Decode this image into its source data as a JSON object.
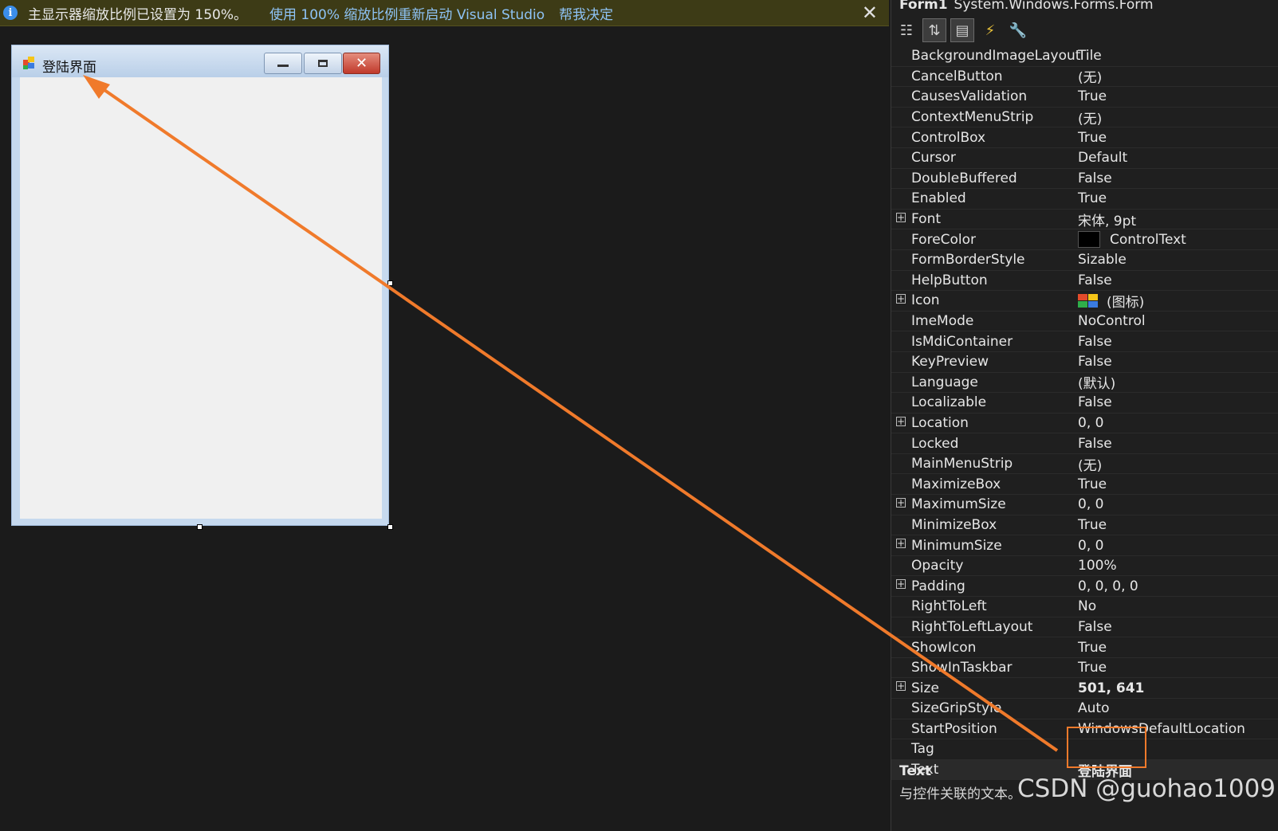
{
  "infobar": {
    "icon": "info-icon",
    "message": "主显示器缩放比例已设置为 150%。",
    "restart_link": "使用 100% 缩放比例重新启动 Visual Studio",
    "decide_link": "帮我决定",
    "close_glyph": "✕"
  },
  "form": {
    "title": "登陆界面",
    "close_glyph": "✕"
  },
  "properties": {
    "object_name": "Form1",
    "object_type": "System.Windows.Forms.Form",
    "toolbar": [
      "categorized-icon",
      "alphabetical-icon",
      "properties-icon",
      "events-icon",
      "property-pages-icon"
    ],
    "rows": [
      {
        "name": "BackgroundImageLayout",
        "value": "Tile"
      },
      {
        "name": "CancelButton",
        "value": "(无)"
      },
      {
        "name": "CausesValidation",
        "value": "True"
      },
      {
        "name": "ContextMenuStrip",
        "value": "(无)"
      },
      {
        "name": "ControlBox",
        "value": "True"
      },
      {
        "name": "Cursor",
        "value": "Default"
      },
      {
        "name": "DoubleBuffered",
        "value": "False"
      },
      {
        "name": "Enabled",
        "value": "True"
      },
      {
        "name": "Font",
        "value": "宋体, 9pt",
        "expandable": true
      },
      {
        "name": "ForeColor",
        "value": "ControlText",
        "swatch": "#000000"
      },
      {
        "name": "FormBorderStyle",
        "value": "Sizable"
      },
      {
        "name": "HelpButton",
        "value": "False"
      },
      {
        "name": "Icon",
        "value": "(图标)",
        "expandable": true,
        "icon": true
      },
      {
        "name": "ImeMode",
        "value": "NoControl"
      },
      {
        "name": "IsMdiContainer",
        "value": "False"
      },
      {
        "name": "KeyPreview",
        "value": "False"
      },
      {
        "name": "Language",
        "value": "(默认)"
      },
      {
        "name": "Localizable",
        "value": "False"
      },
      {
        "name": "Location",
        "value": "0, 0",
        "expandable": true
      },
      {
        "name": "Locked",
        "value": "False"
      },
      {
        "name": "MainMenuStrip",
        "value": "(无)"
      },
      {
        "name": "MaximizeBox",
        "value": "True"
      },
      {
        "name": "MaximumSize",
        "value": "0, 0",
        "expandable": true
      },
      {
        "name": "MinimizeBox",
        "value": "True"
      },
      {
        "name": "MinimumSize",
        "value": "0, 0",
        "expandable": true
      },
      {
        "name": "Opacity",
        "value": "100%"
      },
      {
        "name": "Padding",
        "value": "0, 0, 0, 0",
        "expandable": true
      },
      {
        "name": "RightToLeft",
        "value": "No"
      },
      {
        "name": "RightToLeftLayout",
        "value": "False"
      },
      {
        "name": "ShowIcon",
        "value": "True"
      },
      {
        "name": "ShowInTaskbar",
        "value": "True"
      },
      {
        "name": "Size",
        "value": "501, 641",
        "expandable": true,
        "bold": true
      },
      {
        "name": "SizeGripStyle",
        "value": "Auto"
      },
      {
        "name": "StartPosition",
        "value": "WindowsDefaultLocation"
      },
      {
        "name": "Tag",
        "value": ""
      },
      {
        "name": "Text",
        "value": "登陆界面",
        "bold": true,
        "selected": true
      }
    ],
    "description_title": "Text",
    "description_text": "与控件关联的文本。"
  },
  "watermark": "CSDN @guohao1009",
  "annotation_color": "#f07a2b"
}
